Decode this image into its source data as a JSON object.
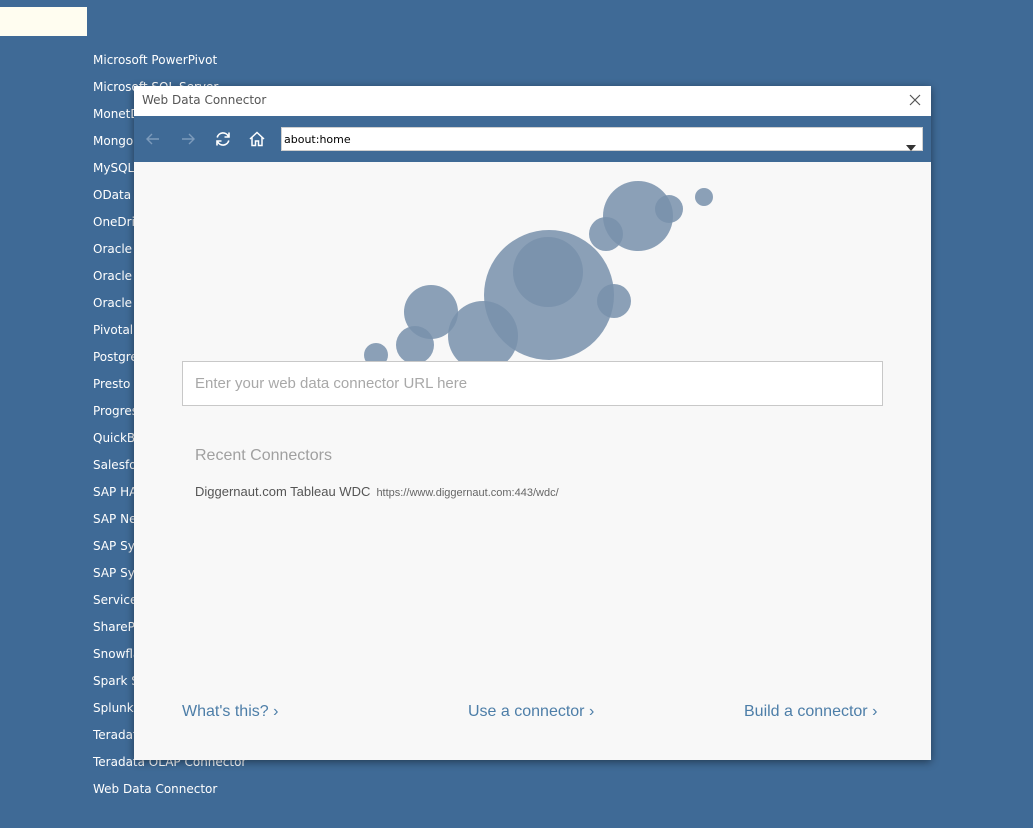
{
  "background_list": {
    "items": [
      "Microsoft PowerPivot",
      "Microsoft SQL Server",
      "MonetDB",
      "MongoDB BI Connector",
      "MySQL",
      "OData",
      "OneDrive",
      "Oracle",
      "Oracle Eloqua",
      "Oracle Essbase",
      "Pivotal Greenplum Database",
      "PostgreSQL",
      "Presto",
      "Progress OpenEdge",
      "QuickBooks Online",
      "Salesforce",
      "SAP HANA",
      "SAP NetWeaver Business Warehouse",
      "SAP Sybase ASE",
      "SAP Sybase IQ",
      "ServiceNow ITSM",
      "SharePoint Lists",
      "Snowflake",
      "Spark SQL",
      "Splunk",
      "Teradata",
      "Teradata OLAP Connector",
      "Web Data Connector"
    ]
  },
  "dialog": {
    "title": "Web Data Connector",
    "toolbar": {
      "address_value": "about:home"
    },
    "url_input": {
      "placeholder": "Enter your web data connector URL here"
    },
    "recent": {
      "heading": "Recent Connectors",
      "items": [
        {
          "name": "Diggernaut.com Tableau WDC",
          "url": "https://www.diggernaut.com:443/wdc/"
        }
      ]
    },
    "links": {
      "whats_this": "What's this? ›",
      "use_connector": "Use a connector ›",
      "build_connector": "Build a connector ›"
    }
  },
  "colors": {
    "background": "#3f6a96",
    "dialog_body": "#f8f8f8",
    "link": "#4d7ea8",
    "bubble": "#7891ab"
  },
  "icons": {
    "back": "arrow-left-icon",
    "forward": "arrow-right-icon",
    "refresh": "refresh-icon",
    "home": "home-icon",
    "close": "close-icon",
    "dropdown": "chevron-down-icon"
  }
}
